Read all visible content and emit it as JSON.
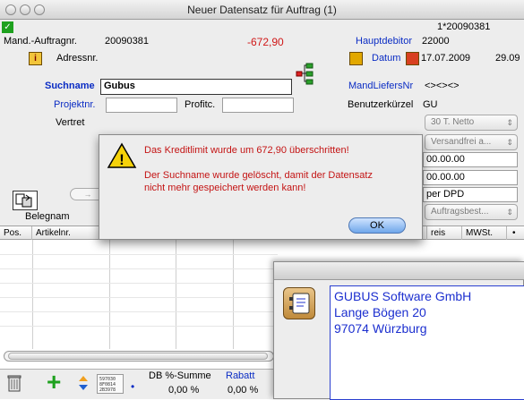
{
  "window": {
    "title": "Neuer Datensatz für Auftrag (1)",
    "record_ref": "1*20090381"
  },
  "header": {
    "mand_label": "Mand.-Auftragnr.",
    "mand_value": "20090381",
    "amount": "-672,90",
    "hauptdebitor_label": "Hauptdebitor",
    "hauptdebitor_value": "22000",
    "adressnr_label": "Adressnr.",
    "datum_label": "Datum",
    "datum_value": "17.07.2009",
    "datum_extra": "29.09",
    "suchname_label": "Suchname",
    "suchname_value": "Gubus",
    "mandliefers_label": "MandLiefersNr",
    "mandliefers_value": "<><><>",
    "projektnr_label": "Projektnr.",
    "profitc_label": "Profitc.",
    "benutzer_label": "Benutzerkürzel",
    "benutzer_value": "GU",
    "vertreter_label": "Vertret",
    "payment_popup": "30 T. Netto",
    "shipping_popup": "Versandfrei a...",
    "field_1": "00.00.00",
    "field_2": "00.00.00",
    "versand_value": "per DPD",
    "belegname_label": "Belegnam",
    "auftragsbest_popup": "Auftragsbest..."
  },
  "table": {
    "columns": [
      "Pos.",
      "Artikelnr.",
      "reis",
      "MWSt."
    ]
  },
  "dialog": {
    "line1": "Das Kreditlimit wurde um 672,90 überschritten!",
    "line2": "Der Suchname wurde gelöscht, damit der Datensatz",
    "line3": "nicht mehr gespeichert werden kann!",
    "ok_label": "OK"
  },
  "bottom": {
    "db_label": "DB %-Summe",
    "db_value": "0,00 %",
    "rabatt_label": "Rabatt",
    "rabatt_value": "0,00 %"
  },
  "address": {
    "line1": "GUBUS Software GmbH",
    "line2": "Lange Bögen 20",
    "line3": "97074 Würzburg"
  },
  "icons": {
    "info": "i",
    "warning": "!",
    "checkmark": "✓",
    "plus": "+",
    "dot": "•",
    "barcode_text": "597030 8F0814 2B3978"
  },
  "colors": {
    "accent_blue": "#0a2cc4",
    "warning_red": "#c41414",
    "check_green": "#1ea11e"
  }
}
